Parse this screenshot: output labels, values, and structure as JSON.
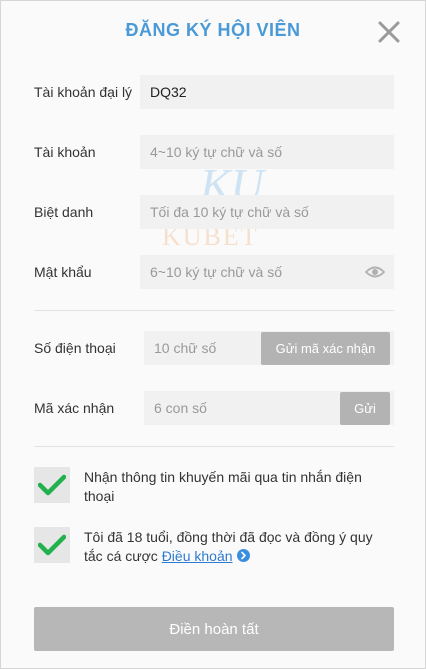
{
  "header": {
    "title": "ĐĂNG KÝ HỘI VIÊN"
  },
  "watermark": {
    "text": "KUBET",
    "letters": "KU"
  },
  "form": {
    "agent": {
      "label": "Tài khoản đại lý",
      "value": "DQ32"
    },
    "account": {
      "label": "Tài khoản",
      "placeholder": "4~10 ký tự chữ và số"
    },
    "nickname": {
      "label": "Biệt danh",
      "placeholder": "Tối đa 10 ký tự chữ và số"
    },
    "password": {
      "label": "Mật khẩu",
      "placeholder": "6~10 ký tự chữ và số"
    },
    "phone": {
      "label": "Số điện thoại",
      "placeholder": "10 chữ số",
      "button": "Gửi mã xác nhận"
    },
    "code": {
      "label": "Mã xác nhận",
      "placeholder": "6 con số",
      "button": "Gửi"
    }
  },
  "consents": {
    "promo": {
      "text": "Nhận thông tin khuyến mãi qua tin nhắn điện thoại",
      "checked": true
    },
    "terms": {
      "text": "Tôi đã 18 tuổi, đồng thời đã đọc và đồng ý quy tắc cá cược",
      "link": "Điều khoản",
      "checked": true
    }
  },
  "submit": {
    "label": "Điền hoàn tất"
  },
  "colors": {
    "title": "#4a9ad8",
    "check": "#22b14c",
    "link": "#2f7ad1"
  }
}
